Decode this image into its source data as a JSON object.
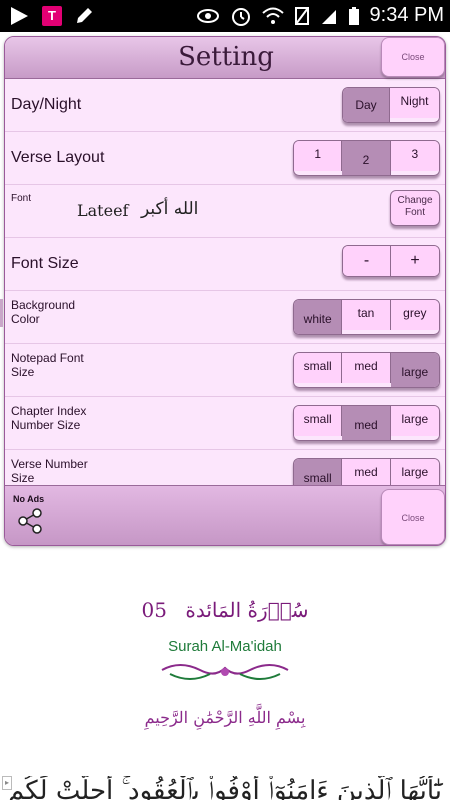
{
  "status_bar": {
    "carrier_badge": "T",
    "time": "9:34 PM",
    "icons": [
      "play-icon",
      "tmobile-icon",
      "pencil-icon",
      "eye-icon",
      "alarm-icon",
      "wifi-icon",
      "no-sim-icon",
      "signal-icon",
      "battery-icon"
    ]
  },
  "dialog": {
    "title": "Setting",
    "close_top": "Close",
    "close_bottom": "Close",
    "no_ads": "No Ads",
    "rows": {
      "day_night": {
        "label": "Day/Night",
        "options": [
          "Day",
          "Night"
        ],
        "selected": "Day"
      },
      "verse_layout": {
        "label": "Verse Layout",
        "options": [
          "1",
          "2",
          "3"
        ],
        "selected": "2"
      },
      "font": {
        "label": "Font",
        "preview_name": "Lateef",
        "preview_arabic": "الله أكبر",
        "button_line1": "Change",
        "button_line2": "Font"
      },
      "font_size": {
        "label": "Font Size",
        "minus": "-",
        "plus": "+"
      },
      "background_color": {
        "label_line1": "Background",
        "label_line2": "Color",
        "options": [
          "white",
          "tan",
          "grey"
        ],
        "selected": "white"
      },
      "notepad_font_size": {
        "label_line1": "Notepad Font",
        "label_line2": "Size",
        "options": [
          "small",
          "med",
          "large"
        ],
        "selected": "large"
      },
      "chapter_index_number_size": {
        "label_line1": "Chapter Index",
        "label_line2": "Number Size",
        "options": [
          "small",
          "med",
          "large"
        ],
        "selected": "med"
      },
      "verse_number_size": {
        "label_line1": "Verse Number",
        "label_line2": "Size",
        "options": [
          "small",
          "med",
          "large"
        ],
        "selected": "small"
      }
    }
  },
  "page": {
    "surah_number": "05",
    "surah_arabic": "سُوۡرَةُ المَائدة",
    "surah_name": "Surah  Al-Ma'idah",
    "basmala": "بِسْمِ اللَّهِ الرَّحْمَٰنِ الرَّحِيمِ",
    "verse_peek": "يَٰٓأَيُّهَا ٱلَّذِينَ ءَامَنُوٓا۟ أَوْفُوا۟ بِٱلْعُقُودِ ۚ أُحِلَّتْ لَكُم"
  },
  "colors": {
    "dialog_bg": "#fce6fc",
    "button_bg": "#ffd2fb",
    "selected_bg": "#b58db5",
    "surah_number_color": "#7a1b7a",
    "surah_name_color": "#1f7b3a"
  }
}
